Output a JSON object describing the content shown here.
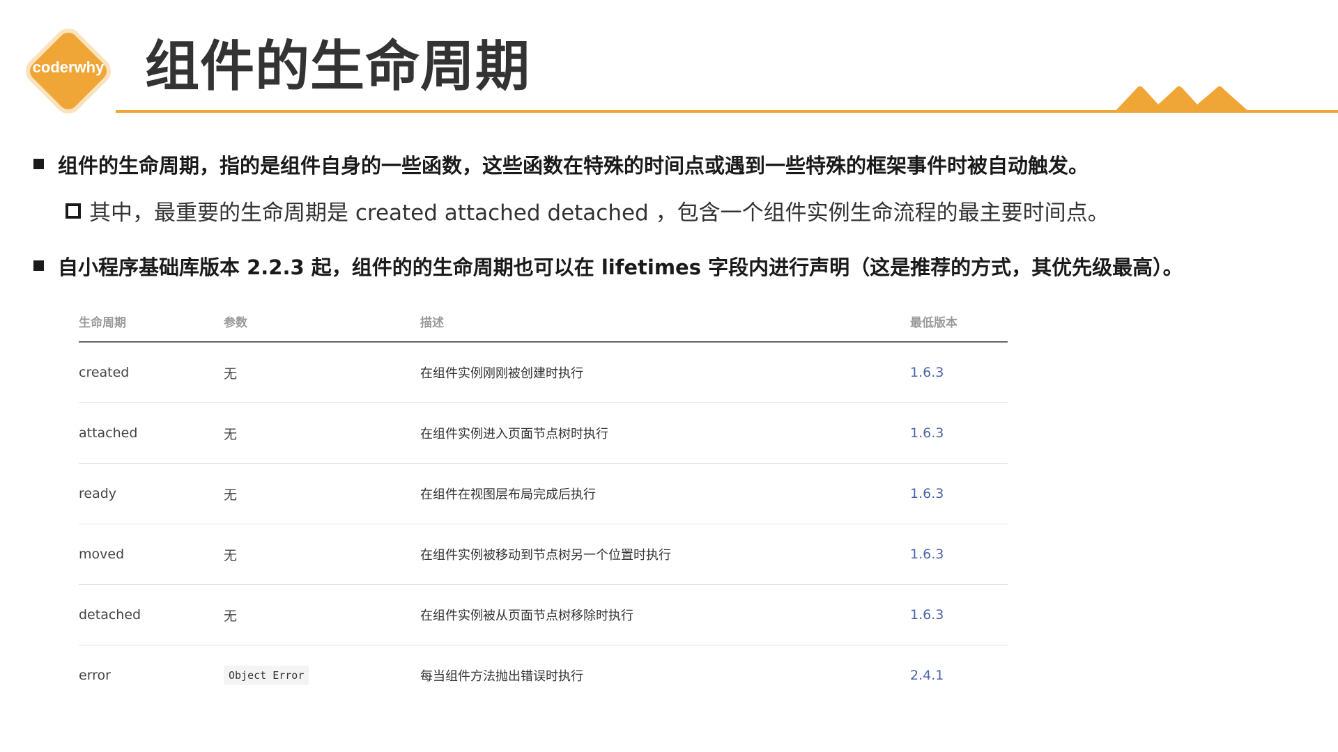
{
  "header": {
    "logo_text": "coderwhy",
    "title": "组件的生命周期"
  },
  "colors": {
    "accent": "#f0a637",
    "title": "#333333",
    "version_link": "#4a64a8"
  },
  "bullets": {
    "b1": "组件的生命周期，指的是组件自身的一些函数，这些函数在特殊的时间点或遇到一些特殊的框架事件时被自动触发。",
    "b2": "其中，最重要的生命周期是 created attached detached ，包含一个组件实例生命流程的最主要时间点。",
    "b3": "自小程序基础库版本 2.2.3 起，组件的的生命周期也可以在 lifetimes 字段内进行声明（这是推荐的方式，其优先级最高）。"
  },
  "table": {
    "headers": [
      "生命周期",
      "参数",
      "描述",
      "最低版本"
    ],
    "rows": [
      {
        "name": "created",
        "param": "无",
        "desc": "在组件实例刚刚被创建时执行",
        "version": "1.6.3"
      },
      {
        "name": "attached",
        "param": "无",
        "desc": "在组件实例进入页面节点树时执行",
        "version": "1.6.3"
      },
      {
        "name": "ready",
        "param": "无",
        "desc": "在组件在视图层布局完成后执行",
        "version": "1.6.3"
      },
      {
        "name": "moved",
        "param": "无",
        "desc": "在组件实例被移动到节点树另一个位置时执行",
        "version": "1.6.3"
      },
      {
        "name": "detached",
        "param": "无",
        "desc": "在组件实例被从页面节点树移除时执行",
        "version": "1.6.3"
      },
      {
        "name": "error",
        "param": "Object Error",
        "desc": "每当组件方法抛出错误时执行",
        "version": "2.4.1"
      }
    ]
  }
}
